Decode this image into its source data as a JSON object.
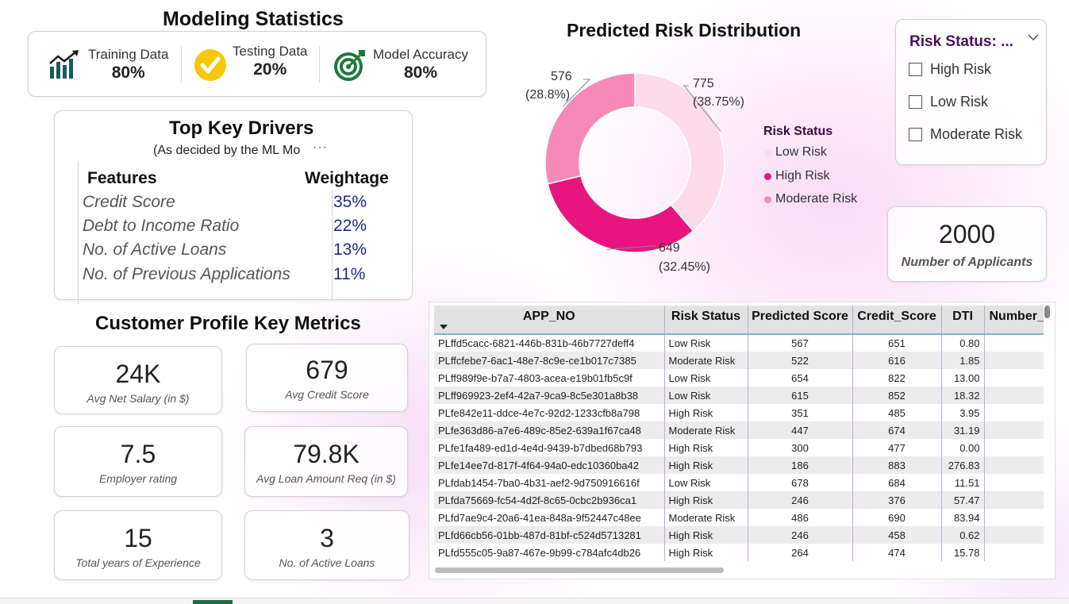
{
  "modeling": {
    "title": "Modeling Statistics",
    "stats": [
      {
        "label": "Training Data",
        "value": "80%"
      },
      {
        "label": "Testing Data",
        "value": "20%"
      },
      {
        "label": "Model Accuracy",
        "value": "80%"
      }
    ]
  },
  "drivers": {
    "title": "Top Key Drivers",
    "subtitle": "(As decided by the ML Mo",
    "more": "···",
    "col_features": "Features",
    "col_weightage": "Weightage",
    "rows": [
      {
        "feature": "Credit Score",
        "weight": "35%"
      },
      {
        "feature": "Debt to Income Ratio",
        "weight": "22%"
      },
      {
        "feature": "No. of Active Loans",
        "weight": "13%"
      },
      {
        "feature": "No. of Previous Applications",
        "weight": "11%"
      }
    ]
  },
  "profile": {
    "title": "Customer Profile Key Metrics",
    "kpis": [
      {
        "value": "24K",
        "caption": "Avg Net Salary (in $)"
      },
      {
        "value": "679",
        "caption": "Avg Credit Score"
      },
      {
        "value": "7.5",
        "caption": "Employer rating"
      },
      {
        "value": "79.8K",
        "caption": "Avg Loan Amount Req (in $)"
      },
      {
        "value": "15",
        "caption": "Total years of Experience"
      },
      {
        "value": "3",
        "caption": "No. of Active Loans"
      }
    ]
  },
  "chart_data": {
    "type": "pie",
    "title": "Predicted Risk Distribution",
    "legend_title": "Risk Status",
    "legend_placement": "right",
    "categories": [
      "Low Risk",
      "High Risk",
      "Moderate Risk"
    ],
    "values": [
      775,
      649,
      576
    ],
    "percent_labels": [
      "(38.75%)",
      "(32.45%)",
      "(28.8%)"
    ],
    "colors": [
      "#fddbea",
      "#e8157f",
      "#f58ab9"
    ]
  },
  "slicer": {
    "title": "Risk Status: ...",
    "options": [
      "High Risk",
      "Low Risk",
      "Moderate Risk"
    ]
  },
  "applicants": {
    "value": "2000",
    "caption": "Number of Applicants"
  },
  "table": {
    "columns": [
      "APP_NO",
      "Risk Status",
      "Predicted Score",
      "Credit_Score",
      "DTI",
      "Number_"
    ],
    "rows": [
      [
        "PLffd5cacc-6821-446b-831b-46b7727deff4",
        "Low Risk",
        "567",
        "651",
        "0.80"
      ],
      [
        "PLffcfebe7-6ac1-48e7-8c9e-ce1b017c7385",
        "Moderate Risk",
        "522",
        "616",
        "1.85"
      ],
      [
        "PLff989f9e-b7a7-4803-acea-e19b01fb5c9f",
        "Low Risk",
        "654",
        "822",
        "13.00"
      ],
      [
        "PLff969923-2ef4-42a7-9ca9-8c5e301a8b38",
        "Low Risk",
        "615",
        "852",
        "18.32"
      ],
      [
        "PLfe842e11-ddce-4e7c-92d2-1233cfb8a798",
        "High Risk",
        "351",
        "485",
        "3.95"
      ],
      [
        "PLfe363d86-a7e6-489c-85e2-639a1f67ca48",
        "Moderate Risk",
        "447",
        "674",
        "31.19"
      ],
      [
        "PLfe1fa489-ed1d-4e4d-9439-b7dbed68b793",
        "High Risk",
        "300",
        "477",
        "0.00"
      ],
      [
        "PLfe14ee7d-817f-4f64-94a0-edc10360ba42",
        "High Risk",
        "186",
        "883",
        "276.83"
      ],
      [
        "PLfdab1454-7ba0-4b31-aef2-9d750916616f",
        "Low Risk",
        "678",
        "684",
        "11.51"
      ],
      [
        "PLfda75669-fc54-4d2f-8c65-0cbc2b936ca1",
        "High Risk",
        "246",
        "376",
        "57.47"
      ],
      [
        "PLfd7ae9c4-20a6-41ea-848a-9f52447c48ee",
        "Moderate Risk",
        "486",
        "690",
        "83.94"
      ],
      [
        "PLfd66cb56-01bb-487d-81bf-c524d5713281",
        "High Risk",
        "246",
        "458",
        "0.62"
      ],
      [
        "PLfd555c05-9a87-467e-9b99-c784afc4db26",
        "High Risk",
        "264",
        "474",
        "15.78"
      ]
    ]
  }
}
